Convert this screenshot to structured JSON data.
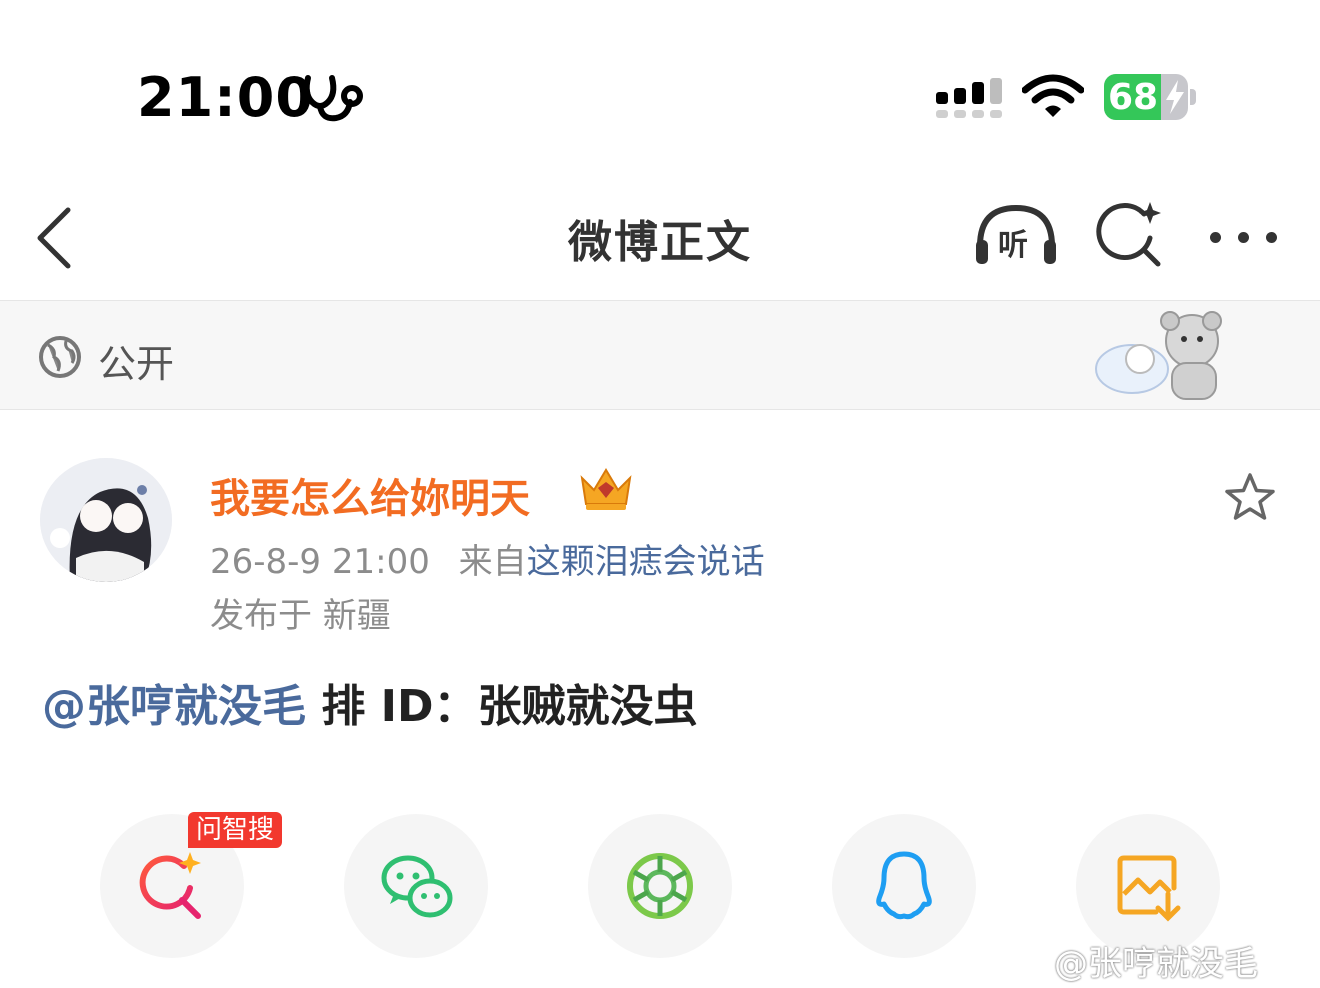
{
  "status_bar": {
    "time": "21:00",
    "battery_level": "68",
    "battery_fraction": 0.68,
    "icons": [
      "stethoscope-icon",
      "cellular-signal-icon",
      "wifi-icon",
      "battery-charging-icon"
    ]
  },
  "nav": {
    "title": "微博正文",
    "listen_label": "听",
    "icons": [
      "back-arrow-icon",
      "headphones-icon",
      "smart-search-icon",
      "more-icon"
    ]
  },
  "visibility": {
    "label": "公开",
    "icon": "globe-icon"
  },
  "post": {
    "username": "我要怎么给妳明天",
    "timestamp": "26-8-9 21:00",
    "source_prefix": "来自",
    "source": "这颗泪痣会说话",
    "location": "发布于 新疆",
    "mention": "@张哼就没毛",
    "text": " 排 ID：张贼就没虫"
  },
  "share": {
    "badge": "问智搜",
    "items": [
      "smart-search-share",
      "wechat",
      "moments",
      "qq",
      "save-image"
    ]
  },
  "colors": {
    "username": "#f26c22",
    "link": "#4a6a9c",
    "battery": "#34c759",
    "badge": "#f2382e"
  },
  "watermark": "@张哼就没毛"
}
